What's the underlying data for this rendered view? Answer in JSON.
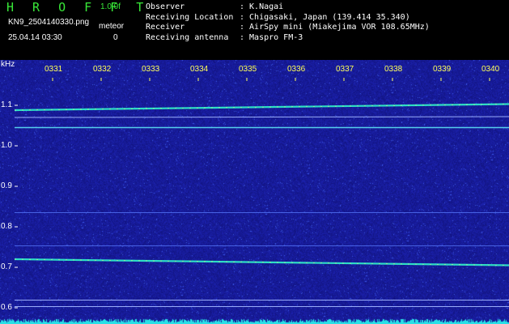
{
  "header": {
    "title": "H R O F F T",
    "version": "1.0.0f",
    "filename": "KN9_2504140330.png",
    "timestamp": "25.04.14 03:30",
    "meteor_label": "meteor",
    "meteor_count": "0"
  },
  "info": [
    {
      "key": "Observer",
      "value": ": K.Nagai"
    },
    {
      "key": "Receiving Location",
      "value": ": Chigasaki, Japan (139.414 35.340)"
    },
    {
      "key": "Receiver",
      "value": ": AirSpy mini (Miakejima VOR 108.65MHz)"
    },
    {
      "key": "Receiving antenna",
      "value": ": Maspro FM-3"
    }
  ],
  "colors": {
    "background": "#1a1e96",
    "title": "#38e838",
    "time_labels": "#ffff5a",
    "band_teal": "#2ee8c8",
    "spectrum_edge": "#28e0e6"
  },
  "chart_data": {
    "type": "heatmap",
    "ylabel": "kHz",
    "yticks": [
      "1.1",
      "1.0",
      "0.9",
      "0.8",
      "0.7",
      "0.6"
    ],
    "ytick_values": [
      1.1,
      1.0,
      0.9,
      0.8,
      0.7,
      0.6
    ],
    "ylim": [
      0.583,
      1.155
    ],
    "xticks": [
      "0331",
      "0332",
      "0333",
      "0334",
      "0335",
      "0336",
      "0337",
      "0338",
      "0339",
      "0340"
    ],
    "carriers": [
      {
        "name": "",
        "freq_start": 1.088,
        "freq_end": 1.103,
        "strength": 0.9
      },
      {
        "name": "",
        "freq_start": 1.07,
        "freq_end": 1.072,
        "strength": 0.3
      },
      {
        "name": "",
        "freq_start": 1.045,
        "freq_end": 1.045,
        "strength": 0.7
      },
      {
        "name": "",
        "freq_start": 0.835,
        "freq_end": 0.835,
        "strength": 0.25
      },
      {
        "name": "",
        "freq_start": 0.753,
        "freq_end": 0.753,
        "strength": 0.25
      },
      {
        "name": "",
        "freq_start": 0.72,
        "freq_end": 0.705,
        "strength": 1.0
      },
      {
        "name": "",
        "freq_start": 0.619,
        "freq_end": 0.619,
        "strength": 0.35
      },
      {
        "name": "",
        "freq_start": 0.603,
        "freq_end": 0.603,
        "strength": 0.35
      }
    ]
  }
}
